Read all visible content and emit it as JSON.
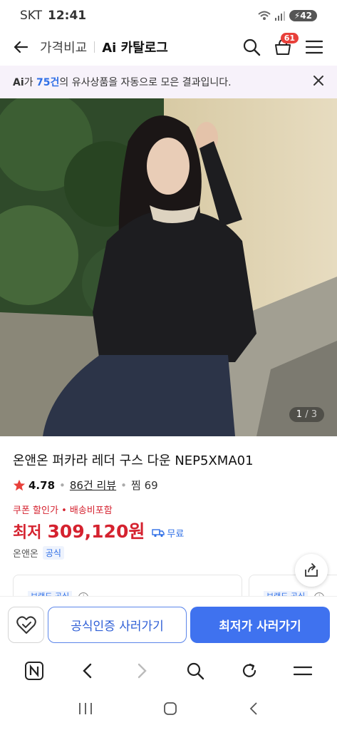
{
  "status_bar": {
    "carrier": "SKT",
    "time": "12:41",
    "battery": "42"
  },
  "header": {
    "section": "가격비교",
    "title": "Ai 카탈로그",
    "cart_count": "61"
  },
  "notice": {
    "ai": "Ai",
    "prefix": "가 ",
    "count": "75건",
    "suffix": "의 유사상품을 자동으로 모은 결과입니다."
  },
  "gallery": {
    "current": "1",
    "separator": " / ",
    "total": "3"
  },
  "product": {
    "title": "온앤온 퍼카라 레더 구스 다운 NEP5XMA01",
    "rating": "4.78",
    "reviews": "86건 리뷰",
    "zzim": "찜 69",
    "coupon_text": "쿠폰 할인가 • 배송비포함",
    "price_label": "최저",
    "price": "309,120원",
    "shipping": "무료",
    "seller": "온앤온",
    "seller_badge": "공식"
  },
  "cards": [
    {
      "tag": "브랜드 공식"
    },
    {
      "tag": "브랜드 공식"
    }
  ],
  "actions": {
    "official_buy": "공식인증 사러가기",
    "lowest_buy": "최저가 사러가기"
  },
  "colors": {
    "accent": "#3f72ef",
    "price": "#d5222f",
    "badge": "#e8403a"
  }
}
